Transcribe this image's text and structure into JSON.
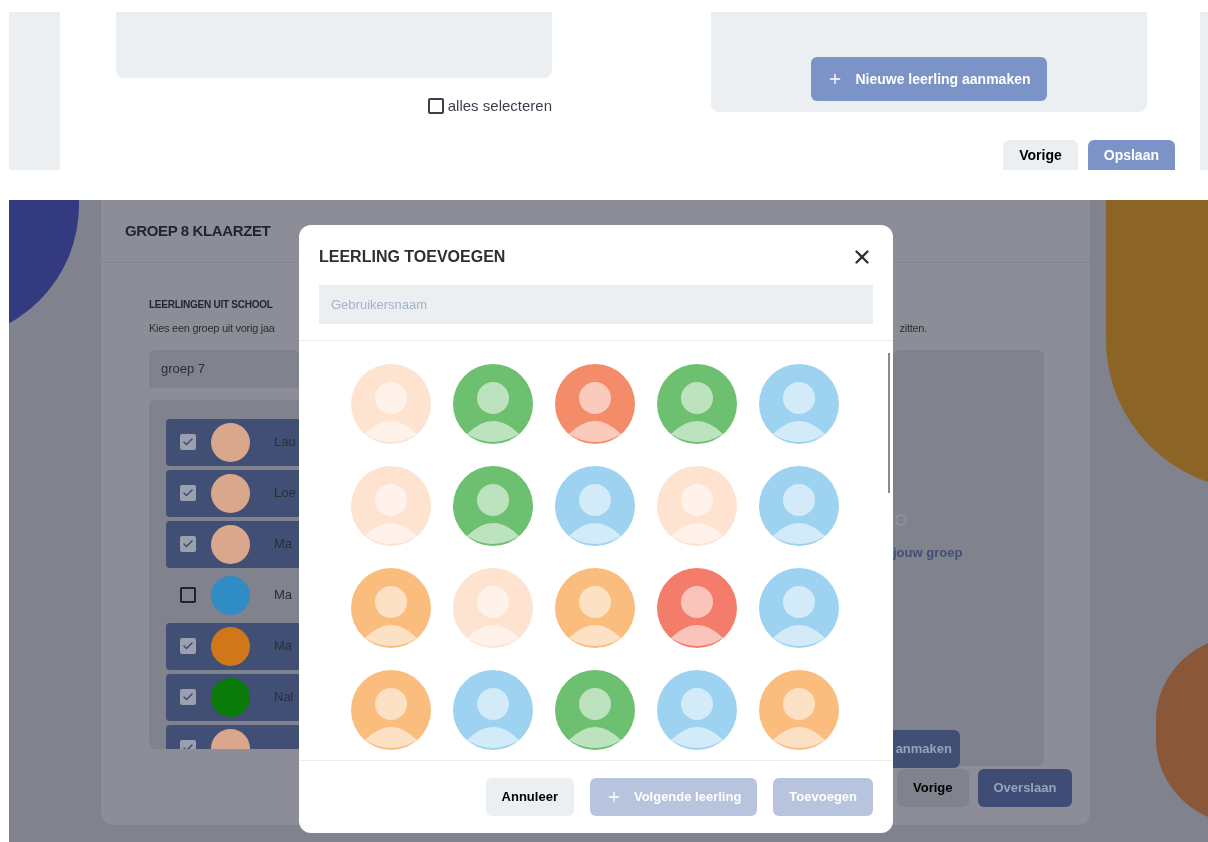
{
  "top_panel": {
    "select_all": {
      "label": "alles selecteren",
      "checked": false
    },
    "new_student_button": "Nieuwe leerling aanmaken",
    "buttons": [
      {
        "label": "Vorige",
        "kind": "secondary"
      },
      {
        "label": "Opslaan",
        "kind": "primary"
      }
    ]
  },
  "page": {
    "title": "GROEP 8 KLAARZET",
    "section_title": "LEERLINGEN UIT SCHOOL",
    "subtitle": "Kies een groep uit vorig jaa",
    "subtitle_end": "zitten.",
    "group_select": "groep 7",
    "students": [
      {
        "name": "Lau",
        "checked": true,
        "color": "#d9a78c"
      },
      {
        "name": "Loe",
        "checked": true,
        "color": "#d9a78c"
      },
      {
        "name": "Ma",
        "checked": true,
        "color": "#d9a78c"
      },
      {
        "name": "Ma",
        "checked": false,
        "color": "#2f8cc4"
      },
      {
        "name": "Ma",
        "checked": true,
        "color": "#d0771a"
      },
      {
        "name": "Nal",
        "checked": true,
        "color": "#0a7a0a"
      },
      {
        "checked": true,
        "color": "#d9a78c"
      }
    ],
    "empty_text": "jouw groep",
    "create_button": "anmaken",
    "buttons": [
      {
        "label": "Vorige",
        "kind": "secondary"
      },
      {
        "label": "Overslaan",
        "kind": "primary"
      }
    ]
  },
  "modal": {
    "title": "LEERLING TOEVOEGEN",
    "search": {
      "placeholder": "Gebruikersnaam"
    },
    "avatars": [
      {
        "color": "#fde3d0"
      },
      {
        "color": "#6cc070"
      },
      {
        "color": "#f48c6a"
      },
      {
        "color": "#6cc070"
      },
      {
        "color": "#9dd3f0"
      },
      {
        "color": "#fde3d0"
      },
      {
        "color": "#6cc070"
      },
      {
        "color": "#9dd3f0"
      },
      {
        "color": "#fde3d0"
      },
      {
        "color": "#9dd3f0"
      },
      {
        "color": "#fbbd7e"
      },
      {
        "color": "#fde3d0"
      },
      {
        "color": "#fbbd7e"
      },
      {
        "color": "#f47c6a"
      },
      {
        "color": "#9dd3f0"
      },
      {
        "color": "#fbbd7e"
      },
      {
        "color": "#9dd3f0"
      },
      {
        "color": "#6cc070"
      },
      {
        "color": "#9dd3f0"
      },
      {
        "color": "#fbbd7e"
      }
    ],
    "buttons": [
      {
        "label": "Annuleer",
        "kind": "cancel",
        "disabled": false
      },
      {
        "label": "Volgende leerling",
        "kind": "next",
        "disabled": true
      },
      {
        "label": "Toevoegen",
        "kind": "add",
        "disabled": true
      }
    ]
  }
}
